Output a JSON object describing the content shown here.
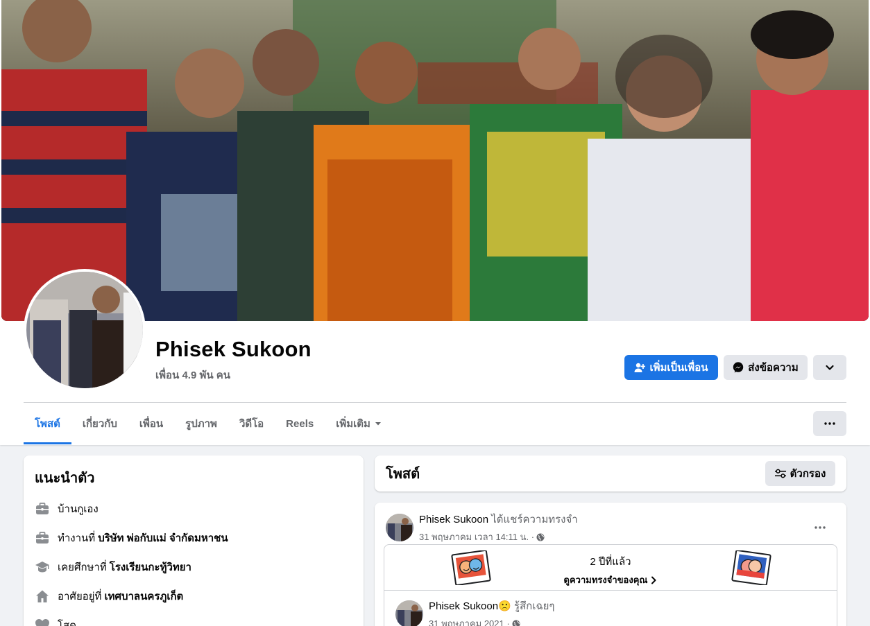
{
  "profile": {
    "name": "Phisek Sukoon",
    "friends": "เพื่อน 4.9 พัน คน"
  },
  "actions": {
    "add_friend": "เพิ่มเป็นเพื่อน",
    "message": "ส่งข้อความ"
  },
  "tabs": [
    {
      "label": "โพสต์",
      "active": true
    },
    {
      "label": "เกี่ยวกับ"
    },
    {
      "label": "เพื่อน"
    },
    {
      "label": "รูปภาพ"
    },
    {
      "label": "วิดีโอ"
    },
    {
      "label": "Reels"
    },
    {
      "label": "เพิ่มเติม"
    }
  ],
  "intro": {
    "title": "แนะนำตัว",
    "items": [
      {
        "icon": "briefcase-icon",
        "text": "บ้านกูเอง",
        "bold": ""
      },
      {
        "icon": "briefcase-icon",
        "text": "ทำงานที่",
        "bold": "บริษัท พ่อกับแม่ จำกัดมหาชน"
      },
      {
        "icon": "graduation-cap-icon",
        "text": "เคยศึกษาที่",
        "bold": "โรงเรียนกะทู้วิทยา"
      },
      {
        "icon": "home-icon",
        "text": "อาศัยอยู่ที่",
        "bold": "เทศบาลนครภูเก็ต"
      },
      {
        "icon": "heart-icon",
        "text": "โสด",
        "bold": ""
      }
    ]
  },
  "posts_section": {
    "title": "โพสต์",
    "filter": "ตัวกรอง"
  },
  "post": {
    "author": "Phisek Sukoon",
    "action": "ได้แชร์ความทรงจำ",
    "time": "31 พฤษภาคม เวลา 14:11 น. ·",
    "memory": {
      "years": "2 ปีที่แล้ว",
      "link": "ดูความทรงจำของคุณ"
    },
    "inner": {
      "author": "Phisek Sukoon",
      "emoji": "🙁",
      "feeling": "รู้สึกเฉยๆ",
      "time": "31 พฤษภาคม 2021 ·"
    }
  },
  "colors": {
    "accent": "#1b74e4",
    "page_bg": "#f0f2f5",
    "secondary_button": "#e4e6eb",
    "muted_text": "#65676b"
  }
}
